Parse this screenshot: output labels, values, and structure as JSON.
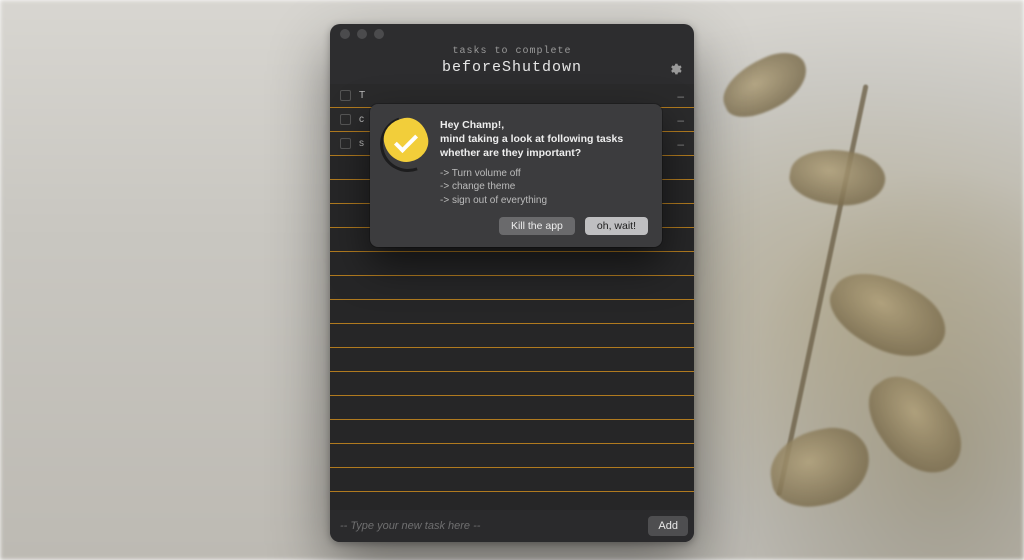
{
  "header": {
    "subtitle": "tasks to complete",
    "title": "beforeShutdown"
  },
  "footer": {
    "placeholder": "-- Type your new task here --",
    "add_label": "Add"
  },
  "dialog": {
    "greeting": "Hey Champ!,",
    "line1": "mind taking a look at following tasks",
    "line2": "whether are they important?",
    "tasks": [
      "Turn volume off",
      "change theme",
      "sign out of everything"
    ],
    "kill_label": "Kill the app",
    "wait_label": "oh, wait!"
  }
}
